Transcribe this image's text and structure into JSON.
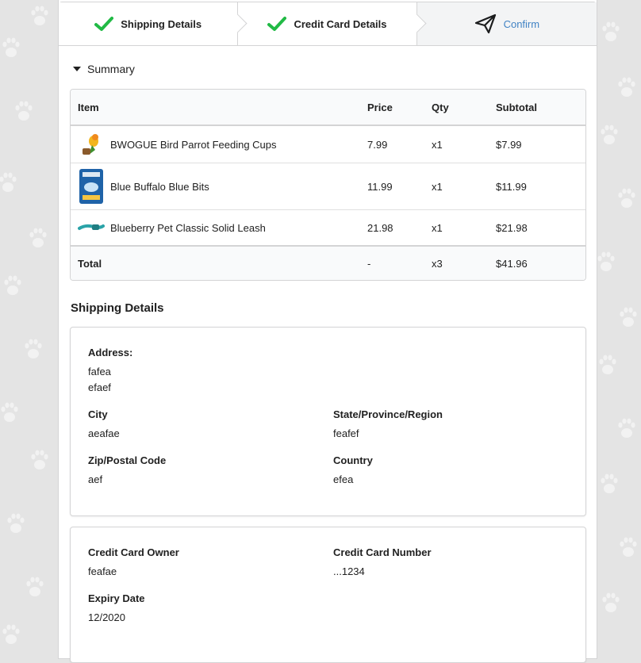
{
  "steps": [
    {
      "label": "Shipping Details",
      "state": "completed"
    },
    {
      "label": "Credit Card Details",
      "state": "completed"
    },
    {
      "label": "Confirm",
      "state": "active"
    }
  ],
  "colors": {
    "check": "#21ba45",
    "active_link": "#4183c4",
    "border": "#d4d4d5"
  },
  "summary": {
    "toggle_label": "Summary",
    "headers": {
      "item": "Item",
      "price": "Price",
      "qty": "Qty",
      "subtotal": "Subtotal"
    },
    "items": [
      {
        "name": "BWOGUE Bird Parrot Feeding Cups",
        "price": "7.99",
        "qty": "x1",
        "subtotal": "$7.99"
      },
      {
        "name": "Blue Buffalo Blue Bits",
        "price": "11.99",
        "qty": "x1",
        "subtotal": "$11.99"
      },
      {
        "name": "Blueberry Pet Classic Solid Leash",
        "price": "21.98",
        "qty": "x1",
        "subtotal": "$21.98"
      }
    ],
    "total": {
      "label": "Total",
      "price": "-",
      "qty": "x3",
      "subtotal": "$41.96"
    }
  },
  "shipping": {
    "title": "Shipping Details",
    "address_label": "Address:",
    "address_line1": "fafea",
    "address_line2": "efaef",
    "city_label": "City",
    "city": "aeafae",
    "state_label": "State/Province/Region",
    "state": "feafef",
    "zip_label": "Zip/Postal Code",
    "zip": "aef",
    "country_label": "Country",
    "country": "efea"
  },
  "payment": {
    "owner_label": "Credit Card Owner",
    "owner": "feafae",
    "number_label": "Credit Card Number",
    "number": "...1234",
    "expiry_label": "Expiry Date",
    "expiry": "12/2020"
  }
}
